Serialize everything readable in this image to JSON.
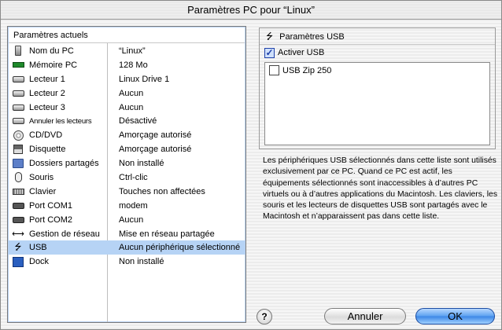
{
  "window": {
    "title": "Paramètres PC pour “Linux”"
  },
  "settings": {
    "header": "Paramètres actuels",
    "rows": [
      {
        "icon": "pc-icon",
        "name": "Nom du PC",
        "value": "“Linux”"
      },
      {
        "icon": "memory-icon",
        "name": "Mémoire PC",
        "value": "128 Mo"
      },
      {
        "icon": "drive-icon",
        "name": "Lecteur 1",
        "value": "Linux Drive 1"
      },
      {
        "icon": "drive-icon",
        "name": "Lecteur 2",
        "value": "Aucun"
      },
      {
        "icon": "drive-icon",
        "name": "Lecteur 3",
        "value": "Aucun"
      },
      {
        "icon": "disabled-drives-icon",
        "name": "Annuler les lecteurs",
        "value": "Désactivé"
      },
      {
        "icon": "cd-icon",
        "name": "CD/DVD",
        "value": "Amorçage autorisé"
      },
      {
        "icon": "floppy-icon",
        "name": "Disquette",
        "value": "Amorçage autorisé"
      },
      {
        "icon": "shared-folder-icon",
        "name": "Dossiers partagés",
        "value": "Non installé"
      },
      {
        "icon": "mouse-icon",
        "name": "Souris",
        "value": "Ctrl-clic"
      },
      {
        "icon": "keyboard-icon",
        "name": "Clavier",
        "value": "Touches non affectées"
      },
      {
        "icon": "port-icon",
        "name": "Port COM1",
        "value": "modem"
      },
      {
        "icon": "port-icon",
        "name": "Port COM2",
        "value": "Aucun"
      },
      {
        "icon": "network-icon",
        "name": "Gestion de réseau",
        "value": "Mise en réseau partagée"
      },
      {
        "icon": "usb-icon",
        "name": "USB",
        "value": "Aucun périphérique sélectionné"
      },
      {
        "icon": "dock-icon",
        "name": "Dock",
        "value": "Non installé"
      }
    ],
    "selected_row": "USB"
  },
  "usb": {
    "title": "Paramètres USB",
    "activate_label": "Activer USB",
    "activate_checked": true,
    "devices": [
      {
        "label": "USB Zip 250",
        "checked": false
      }
    ],
    "description": "Les périphériques USB sélectionnés dans cette liste sont utilisés exclusivement par ce PC. Quand ce PC est actif, les équipements sélectionnés sont inaccessibles à d’autres PC virtuels ou à d’autres applications du Macintosh. Les claviers, les souris et les lecteurs de disquettes USB sont partagés avec le Macintosh et n’apparaissent pas dans cette liste."
  },
  "buttons": {
    "help": "?",
    "cancel": "Annuler",
    "ok": "OK"
  },
  "colors": {
    "selection": "#b6d3f5",
    "ok_button": "#3b86e6"
  }
}
